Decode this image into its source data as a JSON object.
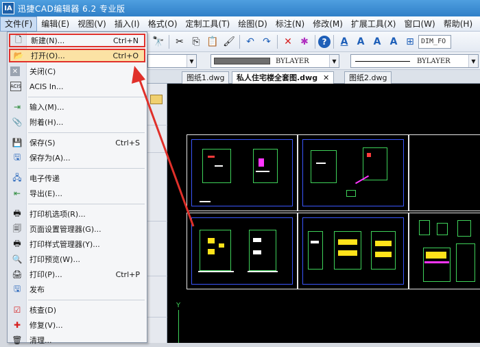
{
  "window": {
    "title": "迅捷CAD编辑器 6.2 专业版",
    "logo_text": "IA"
  },
  "menubar": {
    "items": [
      "文件(F)",
      "编辑(E)",
      "视图(V)",
      "插入(I)",
      "格式(O)",
      "定制工具(T)",
      "绘图(D)",
      "标注(N)",
      "修改(M)",
      "扩展工具(X)",
      "窗口(W)",
      "帮助(H)"
    ]
  },
  "file_menu": {
    "items": [
      {
        "label": "新建(N)...",
        "shortcut": "Ctrl+N",
        "icon": "new-file-icon"
      },
      {
        "label": "打开(O)...",
        "shortcut": "Ctrl+O",
        "icon": "open-file-icon"
      },
      {
        "label": "关闭(C)",
        "shortcut": "",
        "icon": "close-icon"
      },
      {
        "label": "ACIS In...",
        "shortcut": "",
        "icon": "acis-icon"
      },
      {
        "label": "输入(M)...",
        "shortcut": "",
        "icon": "import-icon"
      },
      {
        "label": "附着(H)...",
        "shortcut": "",
        "icon": "attach-icon"
      },
      {
        "label": "保存(S)",
        "shortcut": "Ctrl+S",
        "icon": "save-icon"
      },
      {
        "label": "保存为(A)...",
        "shortcut": "",
        "icon": "save-as-icon"
      },
      {
        "label": "电子传递",
        "shortcut": "",
        "icon": "etransmit-icon"
      },
      {
        "label": "导出(E)...",
        "shortcut": "",
        "icon": "export-icon"
      },
      {
        "label": "打印机选项(R)...",
        "shortcut": "",
        "icon": "printer-options-icon"
      },
      {
        "label": "页面设置管理器(G)...",
        "shortcut": "",
        "icon": "page-setup-icon"
      },
      {
        "label": "打印样式管理器(Y)...",
        "shortcut": "",
        "icon": "plot-style-icon"
      },
      {
        "label": "打印预览(W)...",
        "shortcut": "",
        "icon": "print-preview-icon"
      },
      {
        "label": "打印(P)...",
        "shortcut": "Ctrl+P",
        "icon": "print-icon"
      },
      {
        "label": "发布",
        "shortcut": "",
        "icon": "publish-icon"
      },
      {
        "label": "核查(D)",
        "shortcut": "",
        "icon": "audit-icon"
      },
      {
        "label": "修复(V)...",
        "shortcut": "",
        "icon": "repair-icon"
      },
      {
        "label": "清理...",
        "shortcut": "",
        "icon": "purge-icon"
      }
    ]
  },
  "toolbar": {
    "dim_style": "DIM_FO"
  },
  "properties": {
    "linetype1": "BYLAYER",
    "linetype2": "BYLAYER"
  },
  "tabs": [
    {
      "label": "图纸1.dwg"
    },
    {
      "label": "私人住宅楼全套图.dwg",
      "close": "✕"
    },
    {
      "label": "图纸2.dwg"
    }
  ],
  "canvas": {
    "axis_label": "Y"
  },
  "colors": {
    "highlight": "#e0302a",
    "open_bg": "#fbe2a4",
    "canvas_bg": "#000000"
  }
}
